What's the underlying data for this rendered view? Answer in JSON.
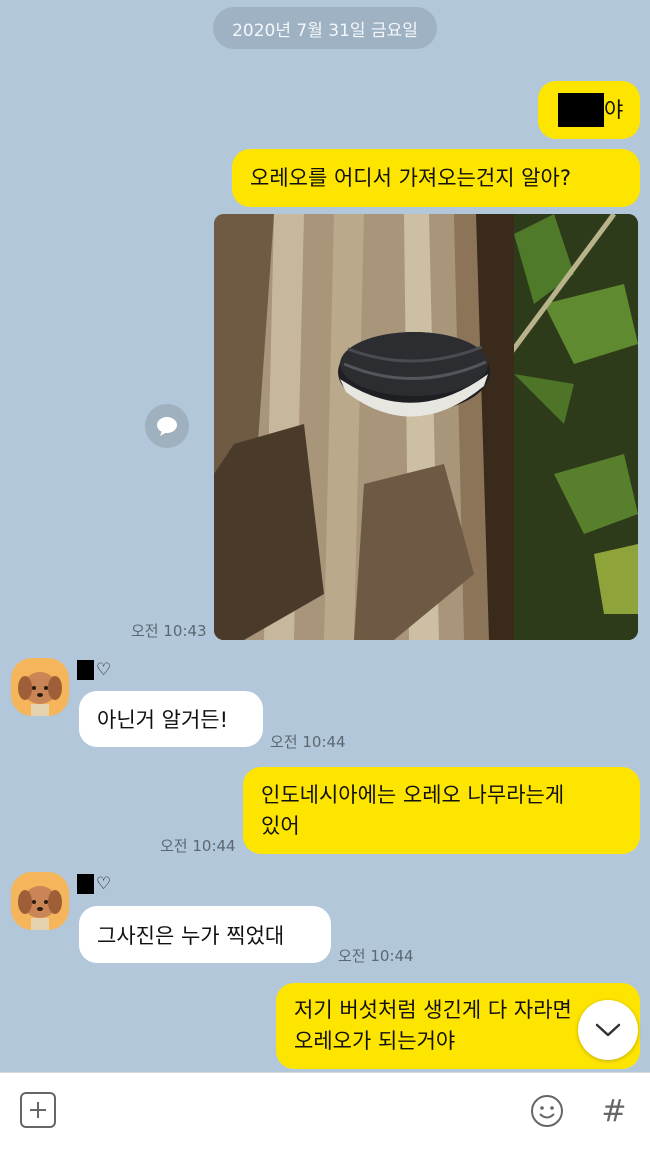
{
  "date_divider": "2020년 7월 31일 금요일",
  "messages": {
    "m1_suffix": "야",
    "m2": "오레오를 어디서 가져오는건지 알아?",
    "photo_time": "오전 10:43",
    "reply1": "아닌거 알거든!",
    "reply1_time": "오전 10:44",
    "m3_line1": "인도네시아에는 오레오 나무라는게",
    "m3_line2": "있어",
    "m3_time": "오전 10:44",
    "reply2": "그사진은 누가 찍었대",
    "reply2_time": "오전 10:44",
    "m4_line1": "저기 버섯처럼 생긴게 다 자라면",
    "m4_line2": "오레오가 되는거야"
  },
  "contact": {
    "heart": "♡"
  },
  "icons": {
    "share": "speech-bubble-icon",
    "scroll": "chevron-down-icon",
    "plus": "plus-icon",
    "emoji": "smiley-icon",
    "hash": "#"
  },
  "colors": {
    "background": "#b2c7d9",
    "my_bubble": "#fee500",
    "other_bubble": "#ffffff"
  }
}
